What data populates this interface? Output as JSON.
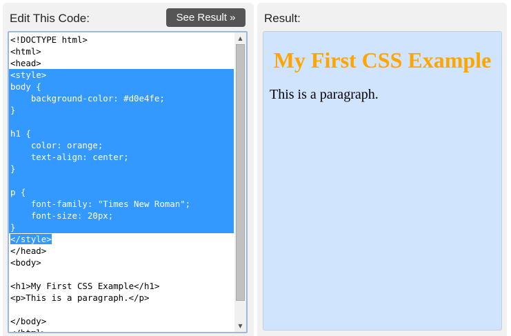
{
  "editor_panel": {
    "title": "Edit This Code:",
    "button_label": "See Result »"
  },
  "result_panel": {
    "title": "Result:"
  },
  "code_lines": [
    "<!DOCTYPE html>",
    "<html>",
    "<head>",
    "<style>",
    "body {",
    "    background-color: #d0e4fe;",
    "}",
    "",
    "h1 {",
    "    color: orange;",
    "    text-align: center;",
    "}",
    "",
    "p {",
    "    font-family: \"Times New Roman\";",
    "    font-size: 20px;",
    "}",
    "</style>",
    "</head>",
    "<body>",
    "",
    "<h1>My First CSS Example</h1>",
    "<p>This is a paragraph.</p>",
    "",
    "</body>",
    "</html>"
  ],
  "selected_lines": [
    3,
    4,
    5,
    6,
    7,
    8,
    9,
    10,
    11,
    12,
    13,
    14,
    15,
    16
  ],
  "partial_selected_line": 17,
  "result": {
    "heading": "My First CSS Example",
    "paragraph": "This is a paragraph."
  },
  "colors": {
    "result_background": "#d0e4fe",
    "heading_color": "orange",
    "selection": "#3399ff",
    "button_bg": "#555555"
  }
}
